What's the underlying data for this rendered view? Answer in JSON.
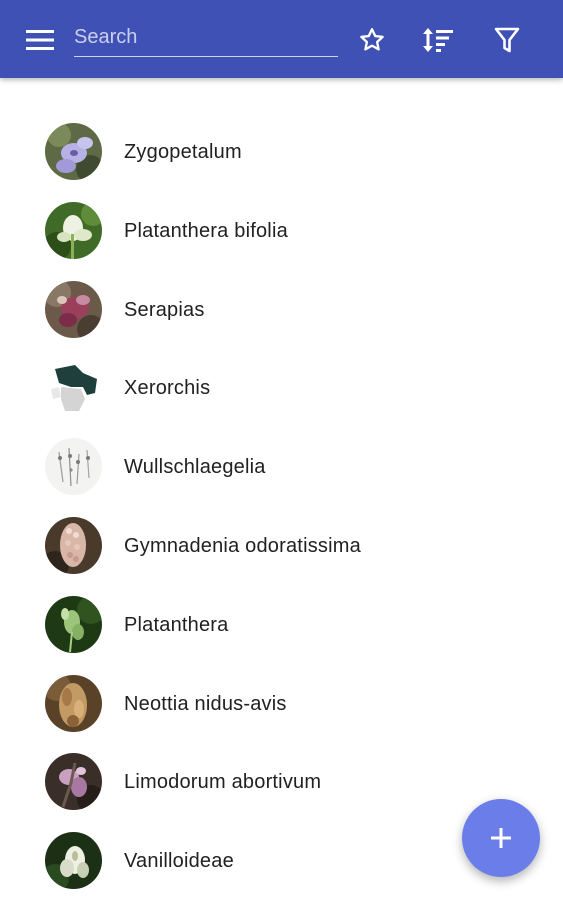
{
  "toolbar": {
    "background": "#3f51b5",
    "search": {
      "placeholder": "Search",
      "value": ""
    },
    "icons": [
      "menu-icon",
      "star-outline-icon",
      "sort-icon",
      "filter-icon"
    ]
  },
  "items": [
    {
      "label": "Zygopetalum",
      "thumb": "zygopetalum"
    },
    {
      "label": "Platanthera bifolia",
      "thumb": "platanthera-bifolia"
    },
    {
      "label": "Serapias",
      "thumb": "serapias"
    },
    {
      "label": "Xerorchis",
      "thumb": "xerorchis"
    },
    {
      "label": "Wullschlaegelia",
      "thumb": "wullschlaegelia"
    },
    {
      "label": "Gymnadenia odoratissima",
      "thumb": "gymnadenia"
    },
    {
      "label": "Platanthera",
      "thumb": "platanthera"
    },
    {
      "label": "Neottia nidus-avis",
      "thumb": "neottia"
    },
    {
      "label": "Limodorum abortivum",
      "thumb": "limodorum"
    },
    {
      "label": "Vanilloideae",
      "thumb": "vanilloideae"
    }
  ],
  "fab": {
    "icon": "plus-icon",
    "color": "#6a7de8"
  }
}
